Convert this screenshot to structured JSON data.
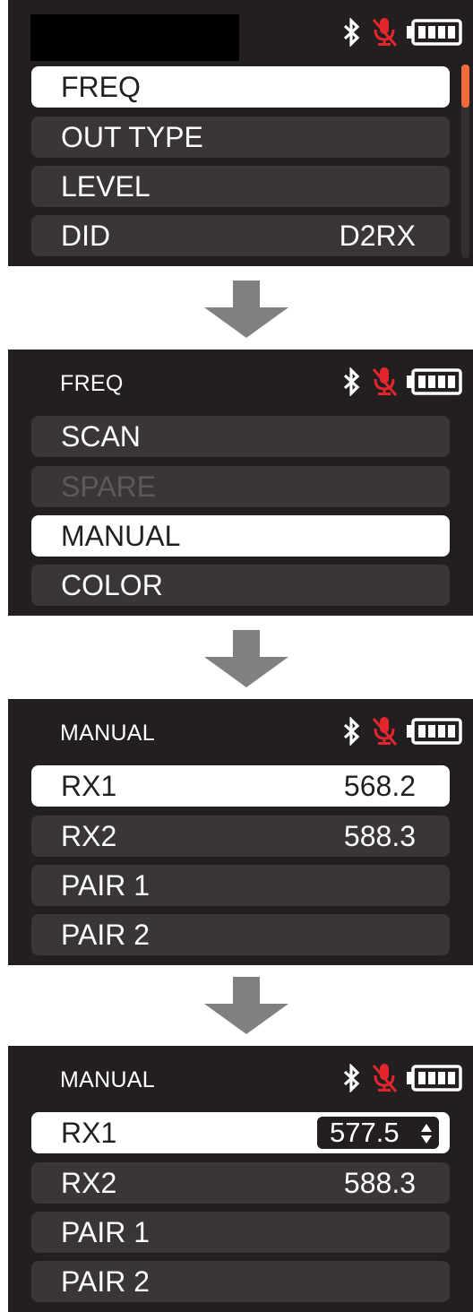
{
  "icons": {
    "bluetooth": "bluetooth-icon",
    "mic": "mic-muted-icon",
    "battery": "battery-full-icon",
    "arrow": "arrow-down-icon",
    "spinner": "up-down-icon"
  },
  "colors": {
    "background": "#231f20",
    "row": "#3a3638",
    "selected": "#ffffff",
    "accent": "#f26b3a",
    "mic": "#e3262b",
    "arrow": "#808080"
  },
  "screens": [
    {
      "title": "",
      "items": [
        {
          "label": "FREQ",
          "value": ""
        },
        {
          "label": "OUT TYPE",
          "value": ""
        },
        {
          "label": "LEVEL",
          "value": ""
        },
        {
          "label": "DID",
          "value": "D2RX"
        }
      ]
    },
    {
      "title": "FREQ",
      "items": [
        {
          "label": "SCAN"
        },
        {
          "label": "SPARE"
        },
        {
          "label": "MANUAL"
        },
        {
          "label": "COLOR"
        }
      ]
    },
    {
      "title": "MANUAL",
      "items": [
        {
          "label": "RX1",
          "value": "568.2"
        },
        {
          "label": "RX2",
          "value": "588.3"
        },
        {
          "label": "PAIR 1",
          "value": ""
        },
        {
          "label": "PAIR 2",
          "value": ""
        }
      ]
    },
    {
      "title": "MANUAL",
      "items": [
        {
          "label": "RX1",
          "value": "577.5"
        },
        {
          "label": "RX2",
          "value": "588.3"
        },
        {
          "label": "PAIR 1",
          "value": ""
        },
        {
          "label": "PAIR 2",
          "value": ""
        }
      ]
    }
  ]
}
